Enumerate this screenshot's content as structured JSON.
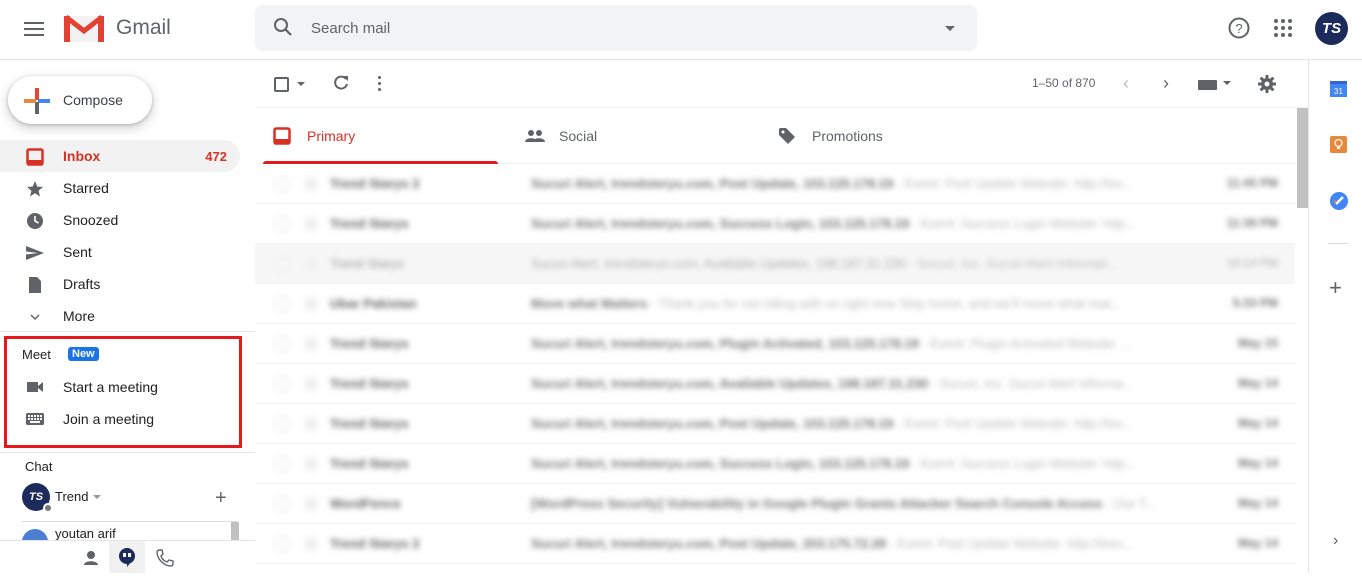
{
  "app": {
    "name": "Gmail"
  },
  "header": {
    "search_placeholder": "Search mail",
    "account_initials": "TS"
  },
  "sidebar": {
    "compose_label": "Compose",
    "items": [
      {
        "label": "Inbox",
        "count": "472",
        "icon": "inbox-icon",
        "active": true
      },
      {
        "label": "Starred",
        "count": "",
        "icon": "star-icon"
      },
      {
        "label": "Snoozed",
        "count": "",
        "icon": "clock-icon"
      },
      {
        "label": "Sent",
        "count": "",
        "icon": "send-icon"
      },
      {
        "label": "Drafts",
        "count": "",
        "icon": "draft-icon"
      },
      {
        "label": "More",
        "count": "",
        "icon": "chevron-down-icon"
      }
    ],
    "meet": {
      "title": "Meet",
      "badge": "New",
      "items": [
        {
          "label": "Start a meeting",
          "icon": "video-camera-icon"
        },
        {
          "label": "Join a meeting",
          "icon": "keyboard-icon"
        }
      ]
    },
    "chat": {
      "title": "Chat",
      "user_name": "Trend",
      "user_initials": "TS",
      "contacts": [
        {
          "name": "youtan arif"
        }
      ]
    }
  },
  "toolbar": {
    "range": "1–50 of 870"
  },
  "tabs": [
    {
      "label": "Primary",
      "active": true
    },
    {
      "label": "Social"
    },
    {
      "label": "Promotions"
    }
  ],
  "emails": [
    {
      "sender": "Trend Starys 2",
      "subject": "Sucuri Alert, trendsterys.com, Post Update, 103.125.178.19",
      "snippet": " - Event: Post Update Website: http://tre...",
      "date": "11:45 PM",
      "unread": true
    },
    {
      "sender": "Trend Starys",
      "subject": "Sucuri Alert, trendsterys.com, Success Login, 103.125.178.19",
      "snippet": " - Event: Success Login Website: http...",
      "date": "11:39 PM",
      "unread": true
    },
    {
      "sender": "Trend Starys",
      "subject": "Sucuri Alert, trendsterys.com, Available Updates, 198.187.31.230",
      "snippet": " - Sucuri, Inc. Sucuri Alert Informati...",
      "date": "10:14 PM",
      "unread": false
    },
    {
      "sender": "Ubar Pakistan",
      "subject": "Move what Matters",
      "snippet": " - Thank you for not riding with us right now Stay home, and we'll move what mat...",
      "date": "5:33 PM",
      "unread": true
    },
    {
      "sender": "Trend Starys",
      "subject": "Sucuri Alert, trendsterys.com, Plugin Activated, 103.125.178.19",
      "snippet": " - Event: Plugin Activated Website: ...",
      "date": "May 15",
      "unread": true
    },
    {
      "sender": "Trend Starys",
      "subject": "Sucuri Alert, trendsterys.com, Available Updates, 198.187.31.230",
      "snippet": " - Sucuri, Inc. Sucuri Alert Informa...",
      "date": "May 14",
      "unread": true
    },
    {
      "sender": "Trend Starys",
      "subject": "Sucuri Alert, trendsterys.com, Post Update, 103.125.178.19",
      "snippet": " - Event: Post Update Website: http://tre...",
      "date": "May 14",
      "unread": true
    },
    {
      "sender": "Trend Starys",
      "subject": "Sucuri Alert, trendsterys.com, Success Login, 103.125.178.19",
      "snippet": " - Event: Success Login Website: http...",
      "date": "May 14",
      "unread": true
    },
    {
      "sender": "WordFence",
      "subject": "[WordPress Security] Vulnerability in Google Plugin Grants Attacker Search Console Access",
      "snippet": " - Our T...",
      "date": "May 14",
      "unread": true
    },
    {
      "sender": "Trend Starys 2",
      "subject": "Sucuri Alert, trendsterys.com, Post Update, 203.175.72.28",
      "snippet": " - Event: Post Update Website: http://tren...",
      "date": "May 14",
      "unread": true
    }
  ],
  "colors": {
    "accent_red": "#d93025",
    "highlight_box": "#e3191b",
    "badge_blue": "#1a73e8"
  }
}
